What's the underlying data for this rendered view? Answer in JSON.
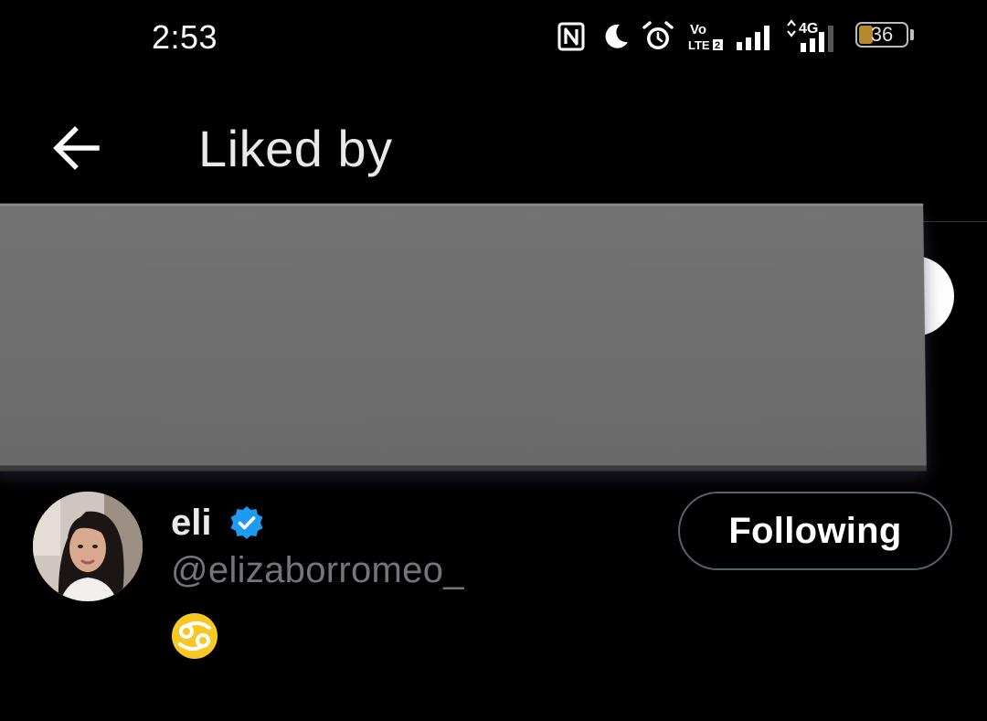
{
  "status_bar": {
    "time": "2:53",
    "battery_level": "36",
    "battery_fill_fraction": 0.36,
    "battery_color": "#b6892e",
    "volte_label": "Vo LTE 2",
    "network_label": "4G",
    "icons": [
      "nfc-icon",
      "moon-icon",
      "alarm-icon",
      "volte-icon",
      "signal-icon",
      "signal-4g-icon",
      "battery-icon"
    ]
  },
  "header": {
    "title": "Liked by",
    "back_icon": "arrow-left-icon"
  },
  "users": [
    {
      "name": "eli",
      "handle": "@elizaborromeo_",
      "verified": true,
      "verified_color": "#1d9bf0",
      "bio_emoji": "♋",
      "button_label": "Following"
    }
  ],
  "colors": {
    "background": "#000000",
    "primary_text": "#e7e9ea",
    "secondary_text": "#71767b",
    "button_border": "#536471",
    "redaction_gray": "#6f6f6f"
  }
}
